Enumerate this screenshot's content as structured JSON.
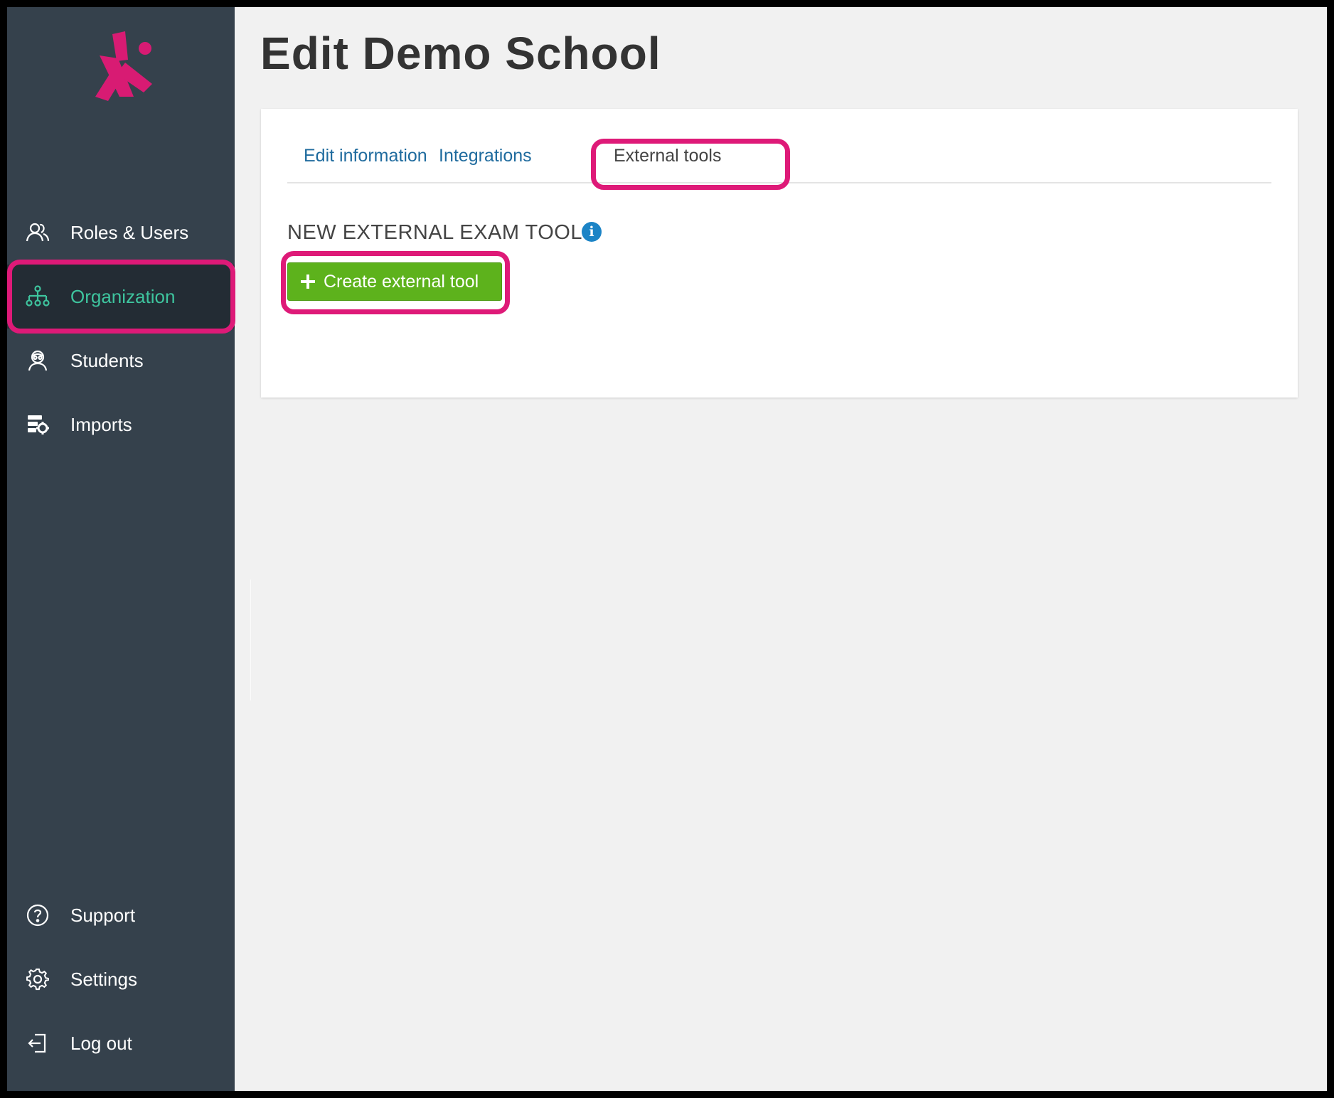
{
  "page": {
    "title": "Edit Demo School"
  },
  "colors": {
    "sidebar_bg": "#35414c",
    "sidebar_active_bg": "#232c34",
    "active_text": "#3ec49e",
    "highlight": "#de1a78",
    "tab_link": "#1f6b9e",
    "button_green": "#5db21c",
    "info_blue": "#1c84c6",
    "logo_pink": "#d81b73"
  },
  "sidebar": {
    "logo_icon": "logo-x-icon",
    "items": [
      {
        "label": "Roles & Users",
        "icon": "users-icon"
      },
      {
        "label": "Organization",
        "icon": "org-chart-icon",
        "active": true
      },
      {
        "label": "Students",
        "icon": "student-icon"
      },
      {
        "label": "Imports",
        "icon": "imports-icon"
      }
    ],
    "bottom_items": [
      {
        "label": "Support",
        "icon": "question-circle-icon"
      },
      {
        "label": "Settings",
        "icon": "gear-icon"
      },
      {
        "label": "Log out",
        "icon": "logout-icon"
      }
    ]
  },
  "tabs": [
    {
      "label": "Edit information"
    },
    {
      "label": "Integrations"
    },
    {
      "label": "External tools",
      "active": true
    }
  ],
  "section": {
    "heading": "NEW EXTERNAL EXAM TOOL",
    "info_icon": "info-icon",
    "button_label": "Create external tool",
    "button_icon": "plus-icon"
  }
}
